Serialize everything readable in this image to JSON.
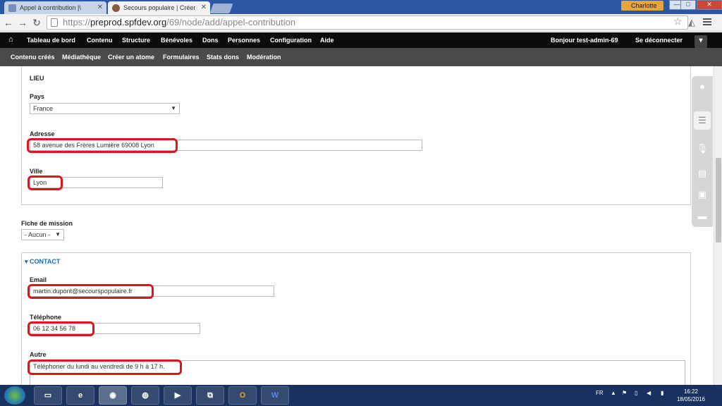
{
  "browser": {
    "tabs": [
      {
        "title": "Appel à contribution |\\",
        "active": false
      },
      {
        "title": "Secours populaire | Créer",
        "active": true
      }
    ],
    "user_chip": "Charlotte",
    "url_protocol": "https://",
    "url_host": "preprod.spfdev.org",
    "url_path": "/69/node/add/appel-contribution",
    "window_buttons": {
      "minimize": "—",
      "maximize": "□",
      "close": "✕"
    }
  },
  "toolbar": {
    "home_icon": "home-icon",
    "items": [
      "Tableau de bord",
      "Contenu",
      "Structure",
      "Bénévoles",
      "Dons",
      "Personnes",
      "Configuration",
      "Aide"
    ],
    "greeting": "Bonjour",
    "username": "test-admin-69",
    "logout": "Se déconnecter"
  },
  "shortcuts": {
    "items": [
      "Contenu créés",
      "Médiathèque",
      "Créer un atome",
      "Formulaires",
      "Stats dons",
      "Modération"
    ]
  },
  "form": {
    "lieu_title": "LIEU",
    "pays_label": "Pays",
    "pays_value": "France",
    "adresse_label": "Adresse",
    "adresse_value": "58 avenue des Frères Lumière 69008 Lyon",
    "ville_label": "Ville",
    "ville_value": "Lyon",
    "fiche_label": "Fiche de mission",
    "fiche_value": "- Aucun -",
    "contact_legend": "▾ CONTACT",
    "email_label": "Email",
    "email_value": "martin.dupont@secourspopulaire.fr",
    "tel_label": "Téléphone",
    "tel_value": "06 12 34 56 78",
    "autre_label": "Autre",
    "autre_value": "Téléphoner du lundi au vendredi de 9 h à 17 h."
  },
  "taskbar": {
    "apps": [
      "explorer",
      "ie",
      "chrome",
      "firefox",
      "media",
      "network",
      "outlook",
      "word"
    ],
    "app_glyphs": {
      "outlook": "O",
      "word": "W"
    },
    "language": "FR",
    "time": "16:22",
    "date": "18/05/2016"
  },
  "colors": {
    "toolbar_bg": "#0c0c0c",
    "shortcut_bg": "#4a4a4a",
    "highlight": "#e0141c",
    "link_blue": "#1a6bb0"
  }
}
